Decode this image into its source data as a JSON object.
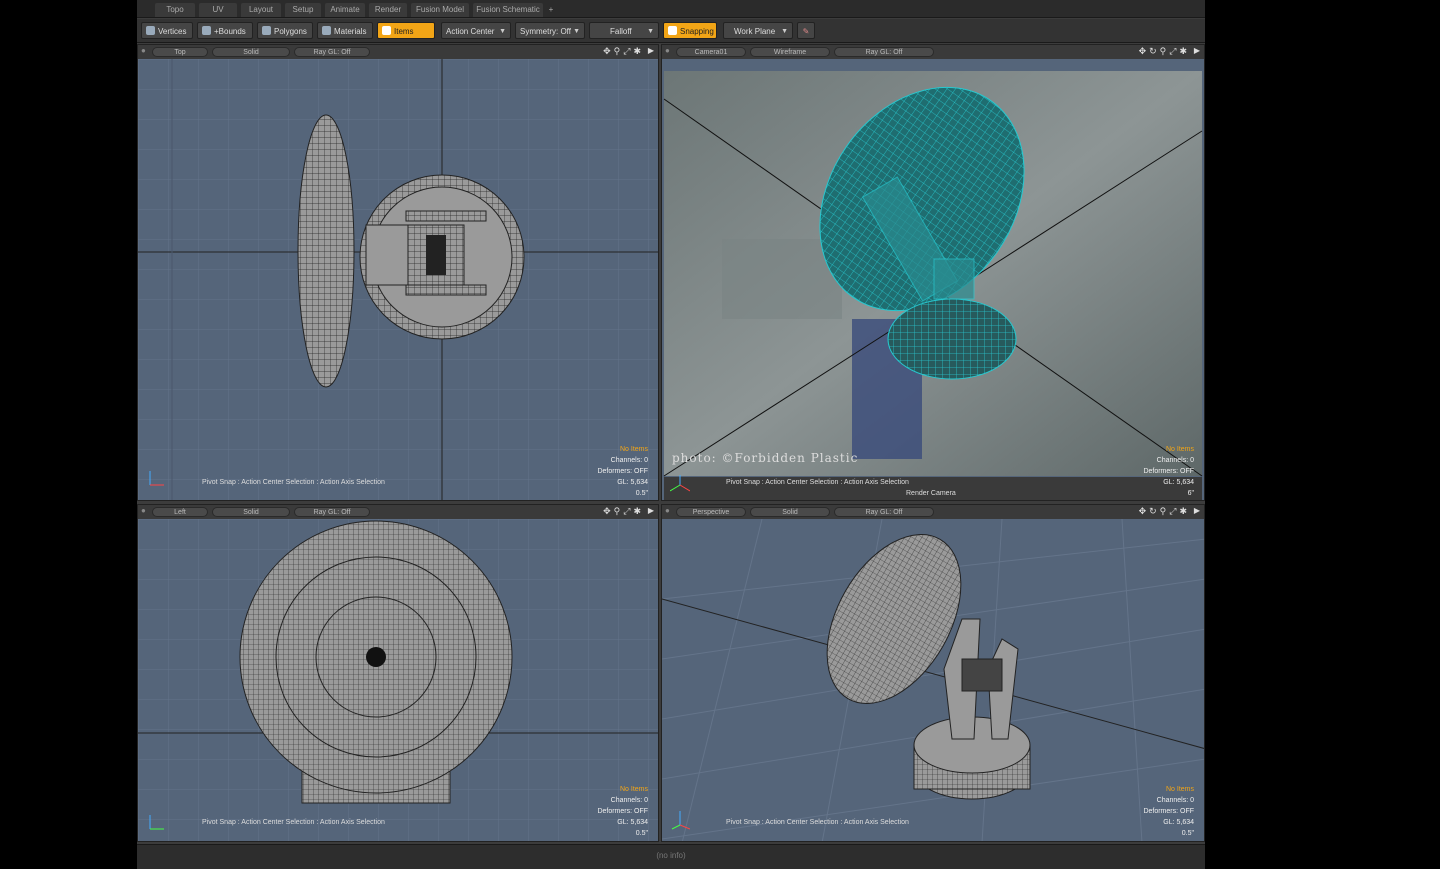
{
  "tabs": [
    "Topo",
    "UV",
    "Layout",
    "Setup",
    "Animate",
    "Render",
    "Fusion Model",
    "Fusion Schematic"
  ],
  "tab_add": "+",
  "toolbar": {
    "vertices": "Vertices",
    "bounds": "+Bounds",
    "polygons": "Polygons",
    "materials": "Materials",
    "items": "Items",
    "action_center": "Action Center",
    "symmetry": "Symmetry: Off",
    "falloff": "Falloff",
    "snapping": "Snapping",
    "work_plane": "Work Plane"
  },
  "viewports": {
    "top_left": {
      "view": "Top",
      "shading": "Solid",
      "raygl": "Ray GL: Off",
      "pivot": "Pivot Snap : Action Center Selection : Action Axis Selection",
      "noitems": "No Items",
      "channels": "Channels: 0",
      "deformers": "Deformers: OFF",
      "gl": "GL: 5,634",
      "scale": "0.5\""
    },
    "top_right": {
      "view": "Camera01",
      "shading": "Wireframe",
      "raygl": "Ray GL: Off",
      "pivot": "Pivot Snap : Action Center Selection : Action Axis Selection",
      "render_camera": "Render Camera",
      "noitems": "No Items",
      "channels": "Channels: 0",
      "deformers": "Deformers: OFF",
      "gl": "GL: 5,634",
      "scale": "6\"",
      "watermark": "photo: ©Forbidden Plastic"
    },
    "bottom_left": {
      "view": "Left",
      "shading": "Solid",
      "raygl": "Ray GL: Off",
      "pivot": "Pivot Snap : Action Center Selection : Action Axis Selection",
      "noitems": "No Items",
      "channels": "Channels: 0",
      "deformers": "Deformers: OFF",
      "gl": "GL: 5,634",
      "scale": "0.5\""
    },
    "bottom_right": {
      "view": "Perspective",
      "shading": "Solid",
      "raygl": "Ray GL: Off",
      "pivot": "Pivot Snap : Action Center Selection : Action Axis Selection",
      "noitems": "No Items",
      "channels": "Channels: 0",
      "deformers": "Deformers: OFF",
      "gl": "GL: 5,634",
      "scale": "0.5\""
    }
  },
  "status": "(no info)",
  "colors": {
    "accent": "#f2a516",
    "viewport_bg": "#55657a",
    "wire_cyan": "#27c8cf"
  }
}
